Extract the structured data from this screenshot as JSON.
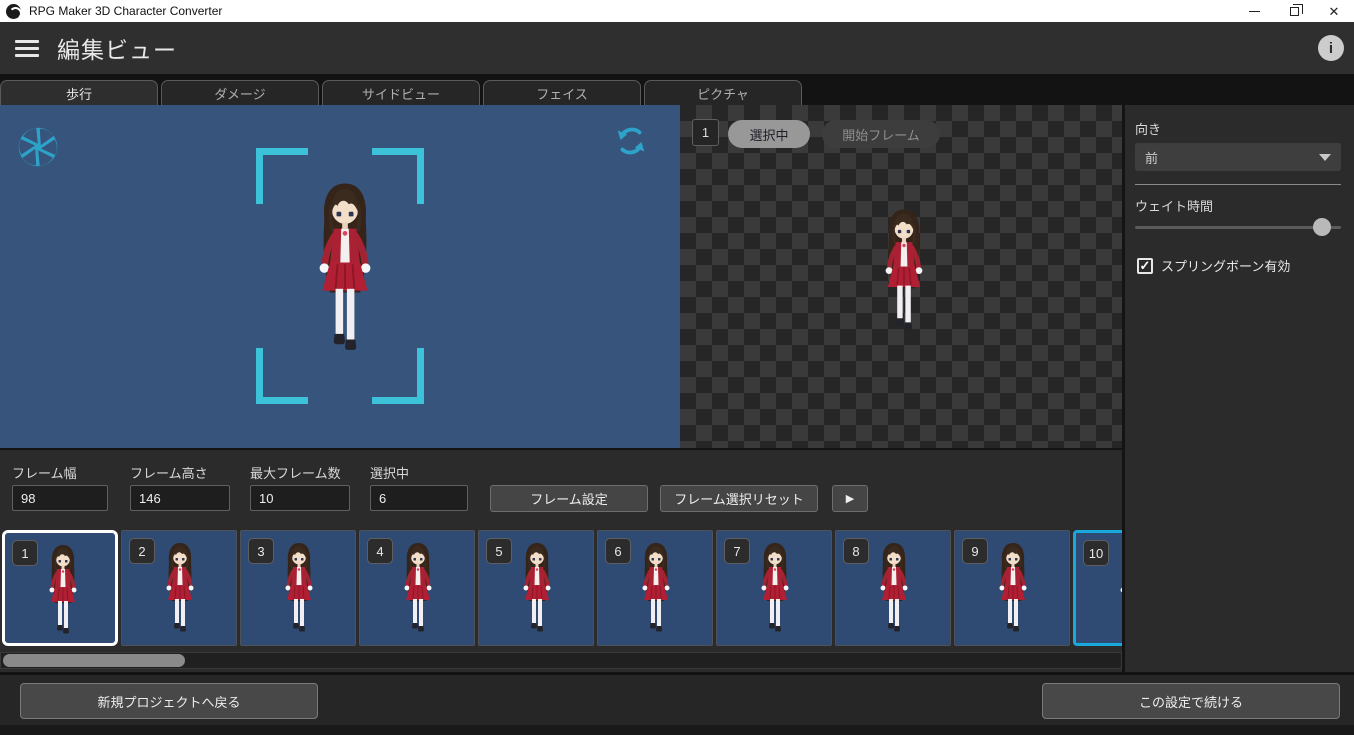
{
  "window": {
    "title": "RPG Maker 3D Character Converter",
    "close_glyph": "✕"
  },
  "header": {
    "title": "編集ビュー",
    "info_glyph": "i"
  },
  "tabs": [
    {
      "label": "歩行",
      "active": true
    },
    {
      "label": "ダメージ",
      "active": false
    },
    {
      "label": "サイドビュー",
      "active": false
    },
    {
      "label": "フェイス",
      "active": false
    },
    {
      "label": "ピクチャ",
      "active": false
    }
  ],
  "sprite_preview": {
    "frame_badge": "1",
    "selected_label": "選択中",
    "start_frame_label": "開始フレーム"
  },
  "sidebar": {
    "direction_label": "向き",
    "direction_value": "前",
    "wait_label": "ウェイト時間",
    "springbone_label": "スプリングボーン有効",
    "springbone_checked": true,
    "checkmark": "✓"
  },
  "settings": {
    "fields": [
      {
        "label": "フレーム幅",
        "value": "98"
      },
      {
        "label": "フレーム高さ",
        "value": "146"
      },
      {
        "label": "最大フレーム数",
        "value": "10"
      },
      {
        "label": "選択中",
        "value": "6"
      }
    ],
    "set_button": "フレーム設定",
    "reset_button": "フレーム選択リセット",
    "play_icon": "▶"
  },
  "frames": [
    {
      "number": "1",
      "state": "selected"
    },
    {
      "number": "2",
      "state": "normal"
    },
    {
      "number": "3",
      "state": "normal"
    },
    {
      "number": "4",
      "state": "normal"
    },
    {
      "number": "5",
      "state": "normal"
    },
    {
      "number": "6",
      "state": "normal"
    },
    {
      "number": "7",
      "state": "normal"
    },
    {
      "number": "8",
      "state": "normal"
    },
    {
      "number": "9",
      "state": "normal"
    },
    {
      "number": "10",
      "state": "highlight"
    }
  ],
  "footer": {
    "back_label": "新規プロジェクトへ戻る",
    "continue_label": "この設定で続ける"
  },
  "colors": {
    "accent_cyan": "#3cc3da",
    "preview_blue": "#37547c",
    "tile_blue": "#2f4b73",
    "frame_selected_border": "#ffffff",
    "frame_highlight_border": "#18a8dc"
  }
}
